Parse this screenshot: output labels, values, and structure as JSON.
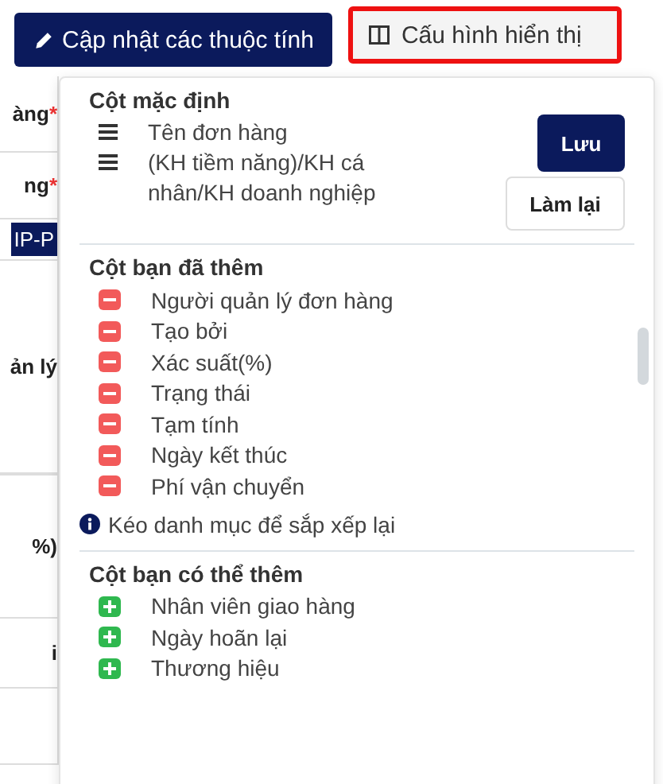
{
  "toolbar": {
    "update_button": "Cập nhật các thuộc tính",
    "config_button": {
      "label": "Cấu hình hiển thị",
      "highlighted": true
    }
  },
  "background_rows": [
    {
      "kind": "label",
      "text": "àng",
      "mark": "*"
    },
    {
      "kind": "label",
      "text": "ng",
      "mark": "*"
    },
    {
      "kind": "chip",
      "text": "IP-P"
    },
    {
      "kind": "label",
      "text": "ản lý"
    },
    {
      "kind": "empty"
    },
    {
      "kind": "label",
      "text": "%)"
    },
    {
      "kind": "label",
      "text": "i"
    },
    {
      "kind": "empty"
    }
  ],
  "dropdown": {
    "default_section": {
      "title": "Cột mặc định",
      "items": [
        "Tên đơn hàng",
        "(KH tiềm năng)/KH cá nhân/KH doanh nghiệp"
      ],
      "save_button": "Lưu",
      "reset_button": "Làm lại"
    },
    "added_section": {
      "title": "Cột bạn đã thêm",
      "items": [
        "Người quản lý đơn hàng",
        "Tạo bởi",
        "Xác suất(%)",
        "Trạng thái",
        "Tạm tính",
        "Ngày kết thúc",
        "Phí vận chuyển"
      ],
      "hint": "Kéo danh mục để sắp xếp lại"
    },
    "available_section": {
      "title": "Cột bạn có thể thêm",
      "items": [
        "Nhân viên giao hàng",
        "Ngày hoãn lại",
        "Thương hiệu"
      ]
    }
  }
}
